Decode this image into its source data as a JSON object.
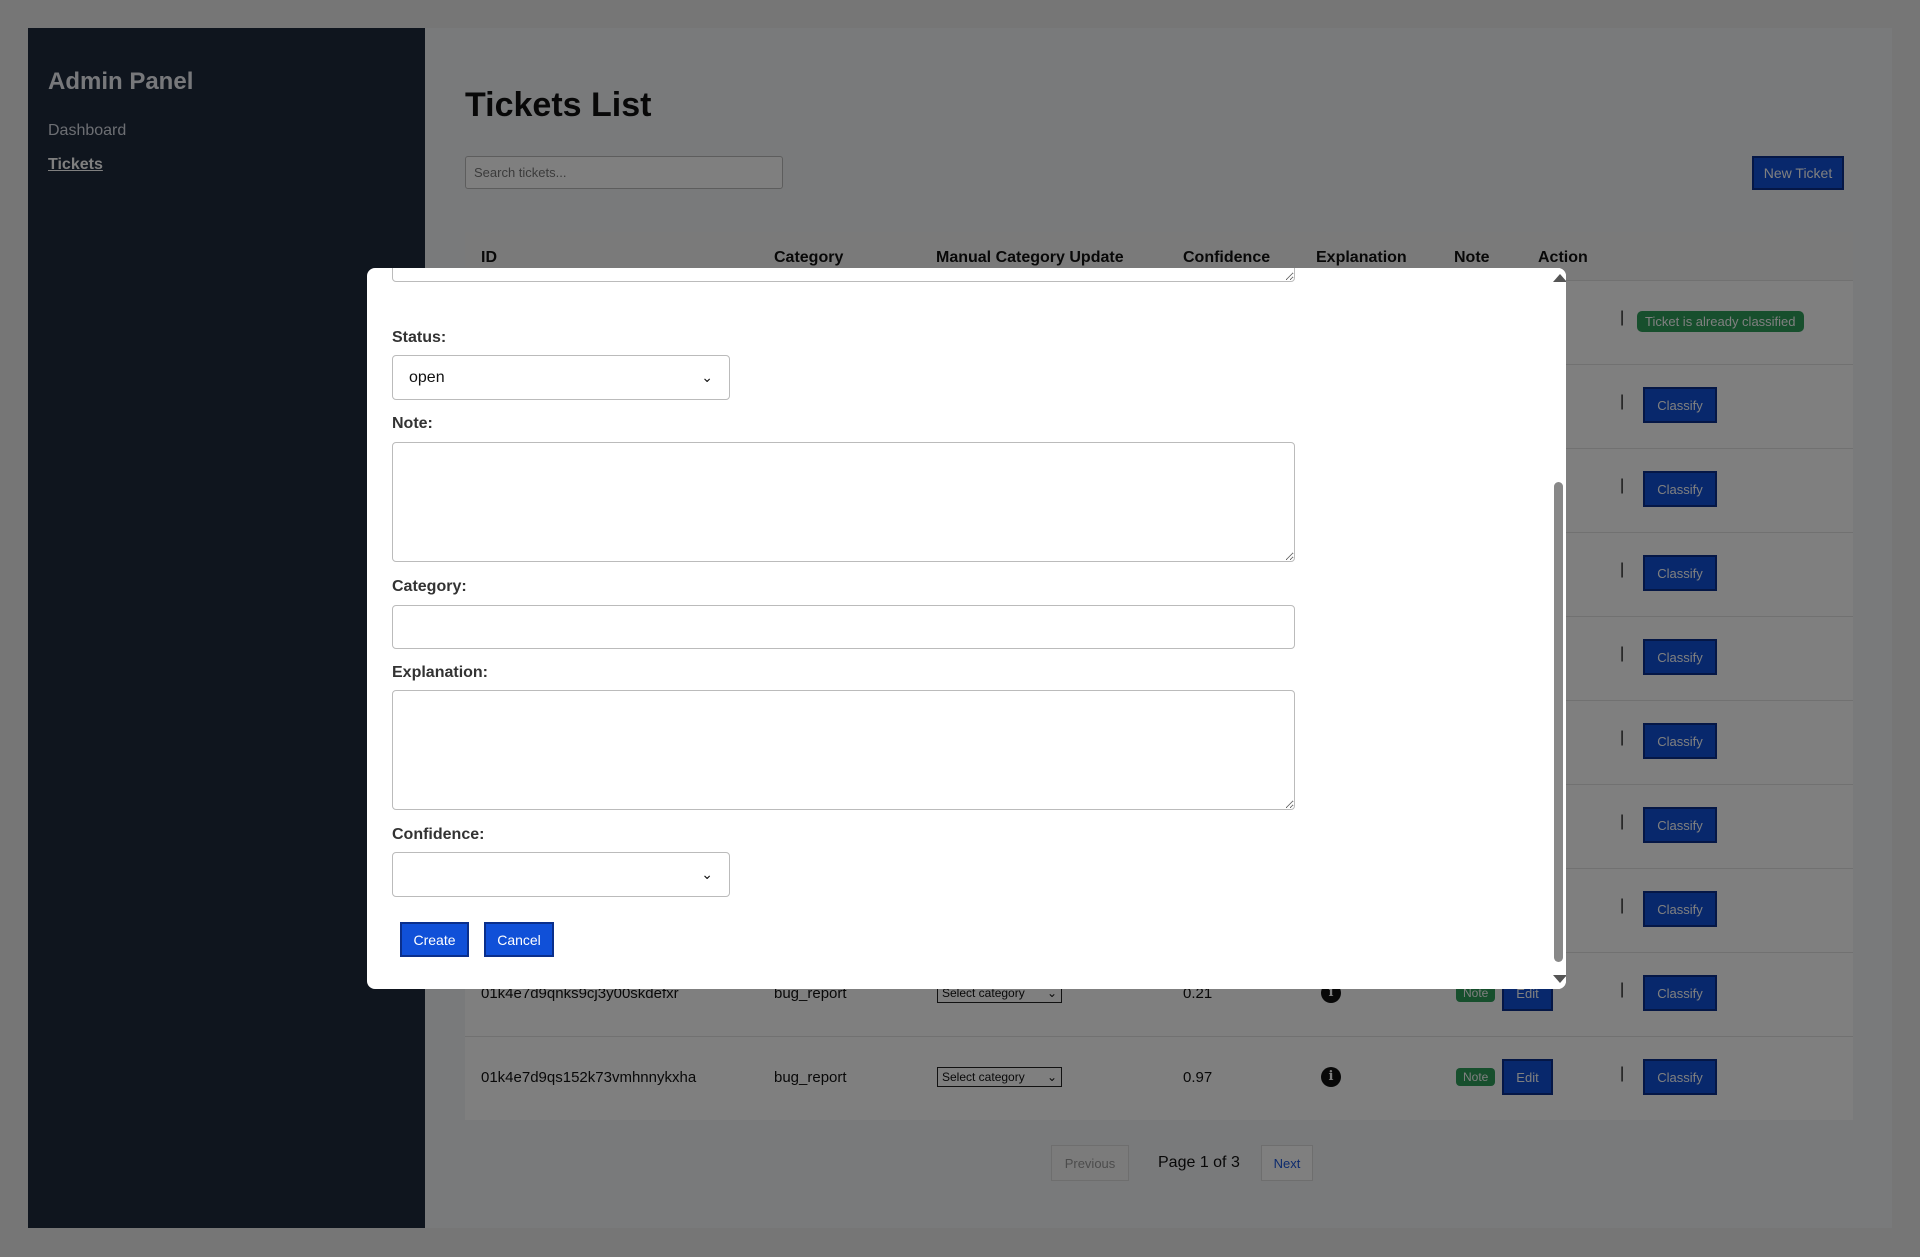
{
  "sidebar": {
    "brand": "Admin Panel",
    "items": [
      {
        "label": "Dashboard"
      },
      {
        "label": "Tickets"
      }
    ]
  },
  "main": {
    "title": "Tickets List",
    "search_placeholder": "Search tickets...",
    "new_ticket_label": "New Ticket",
    "columns": [
      "ID",
      "Category",
      "Manual Category Update",
      "Confidence",
      "Explanation",
      "Note",
      "Action"
    ],
    "classified_label": "Ticket is already classified",
    "edit_label": "Edit",
    "classify_label": "Classify",
    "separator": "|",
    "select_category_label": "Select category",
    "note_label": "Note",
    "info_glyph": "i",
    "rows": [
      {
        "id": "01k4e7d9qnks9cj3y00skdefxr",
        "category": "bug_report",
        "confidence": "0.21"
      },
      {
        "id": "01k4e7d9qs152k73vmhnnykxha",
        "category": "bug_report",
        "confidence": "0.97"
      }
    ]
  },
  "pagination": {
    "prev_label": "Previous",
    "page_info": "Page 1 of 3",
    "next_label": "Next"
  },
  "modal": {
    "status_label": "Status:",
    "status_value": "open",
    "note_label": "Note:",
    "category_label": "Category:",
    "explanation_label": "Explanation:",
    "confidence_label": "Confidence:",
    "confidence_value": "",
    "create_label": "Create",
    "cancel_label": "Cancel"
  },
  "colors": {
    "sidebar_bg": "#1f2a3c",
    "primary_button": "#1050d8",
    "badge_green": "#2e9e5a"
  }
}
